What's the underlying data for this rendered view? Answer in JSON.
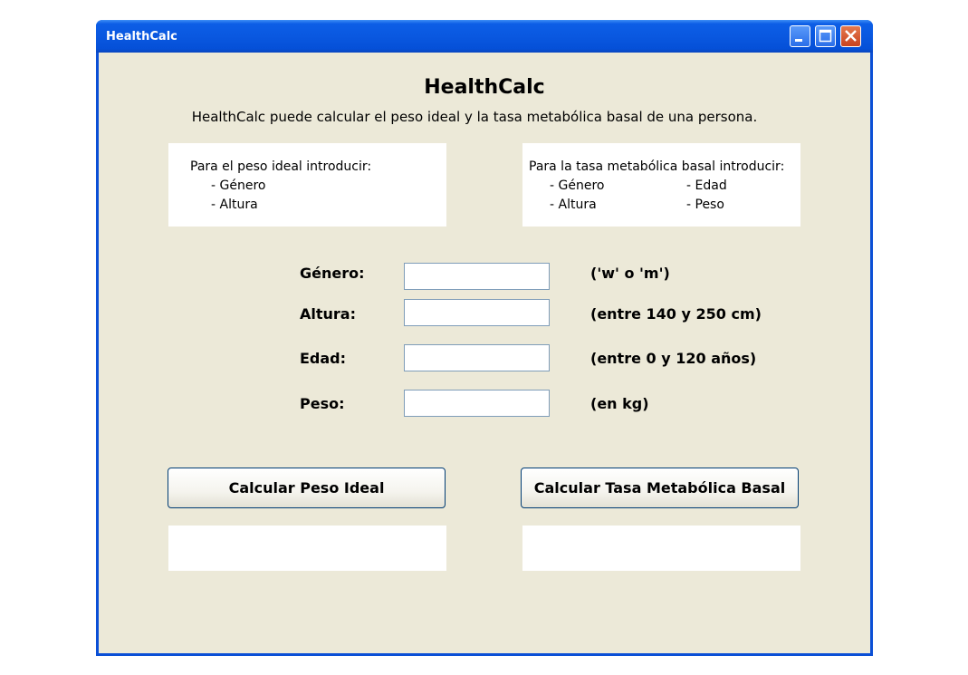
{
  "window": {
    "title": "HealthCalc"
  },
  "header": {
    "title": "HealthCalc",
    "description": "HealthCalc puede calcular el peso ideal y la tasa metabólica basal de una persona."
  },
  "info_ideal": {
    "heading": "Para el peso ideal introducir:",
    "items": [
      "- Género",
      "- Altura"
    ]
  },
  "info_bmr": {
    "heading": "Para la tasa metabólica basal introducir:",
    "items": [
      "- Género",
      "- Edad",
      "- Altura",
      "- Peso"
    ]
  },
  "form": {
    "gender": {
      "label": "Género:",
      "value": "",
      "hint": "('w' o 'm')"
    },
    "height": {
      "label": "Altura:",
      "value": "",
      "hint": "(entre 140 y 250 cm)"
    },
    "age": {
      "label": "Edad:",
      "value": "",
      "hint": "(entre 0 y 120 años)"
    },
    "weight": {
      "label": "Peso:",
      "value": "",
      "hint": "(en kg)"
    }
  },
  "buttons": {
    "ideal_weight": "Calcular Peso Ideal",
    "bmr": "Calcular Tasa Metabólica Basal"
  },
  "results": {
    "ideal_weight": "",
    "bmr": ""
  },
  "icons": {
    "minimize": "minimize-icon",
    "maximize": "maximize-icon",
    "close": "close-icon"
  }
}
